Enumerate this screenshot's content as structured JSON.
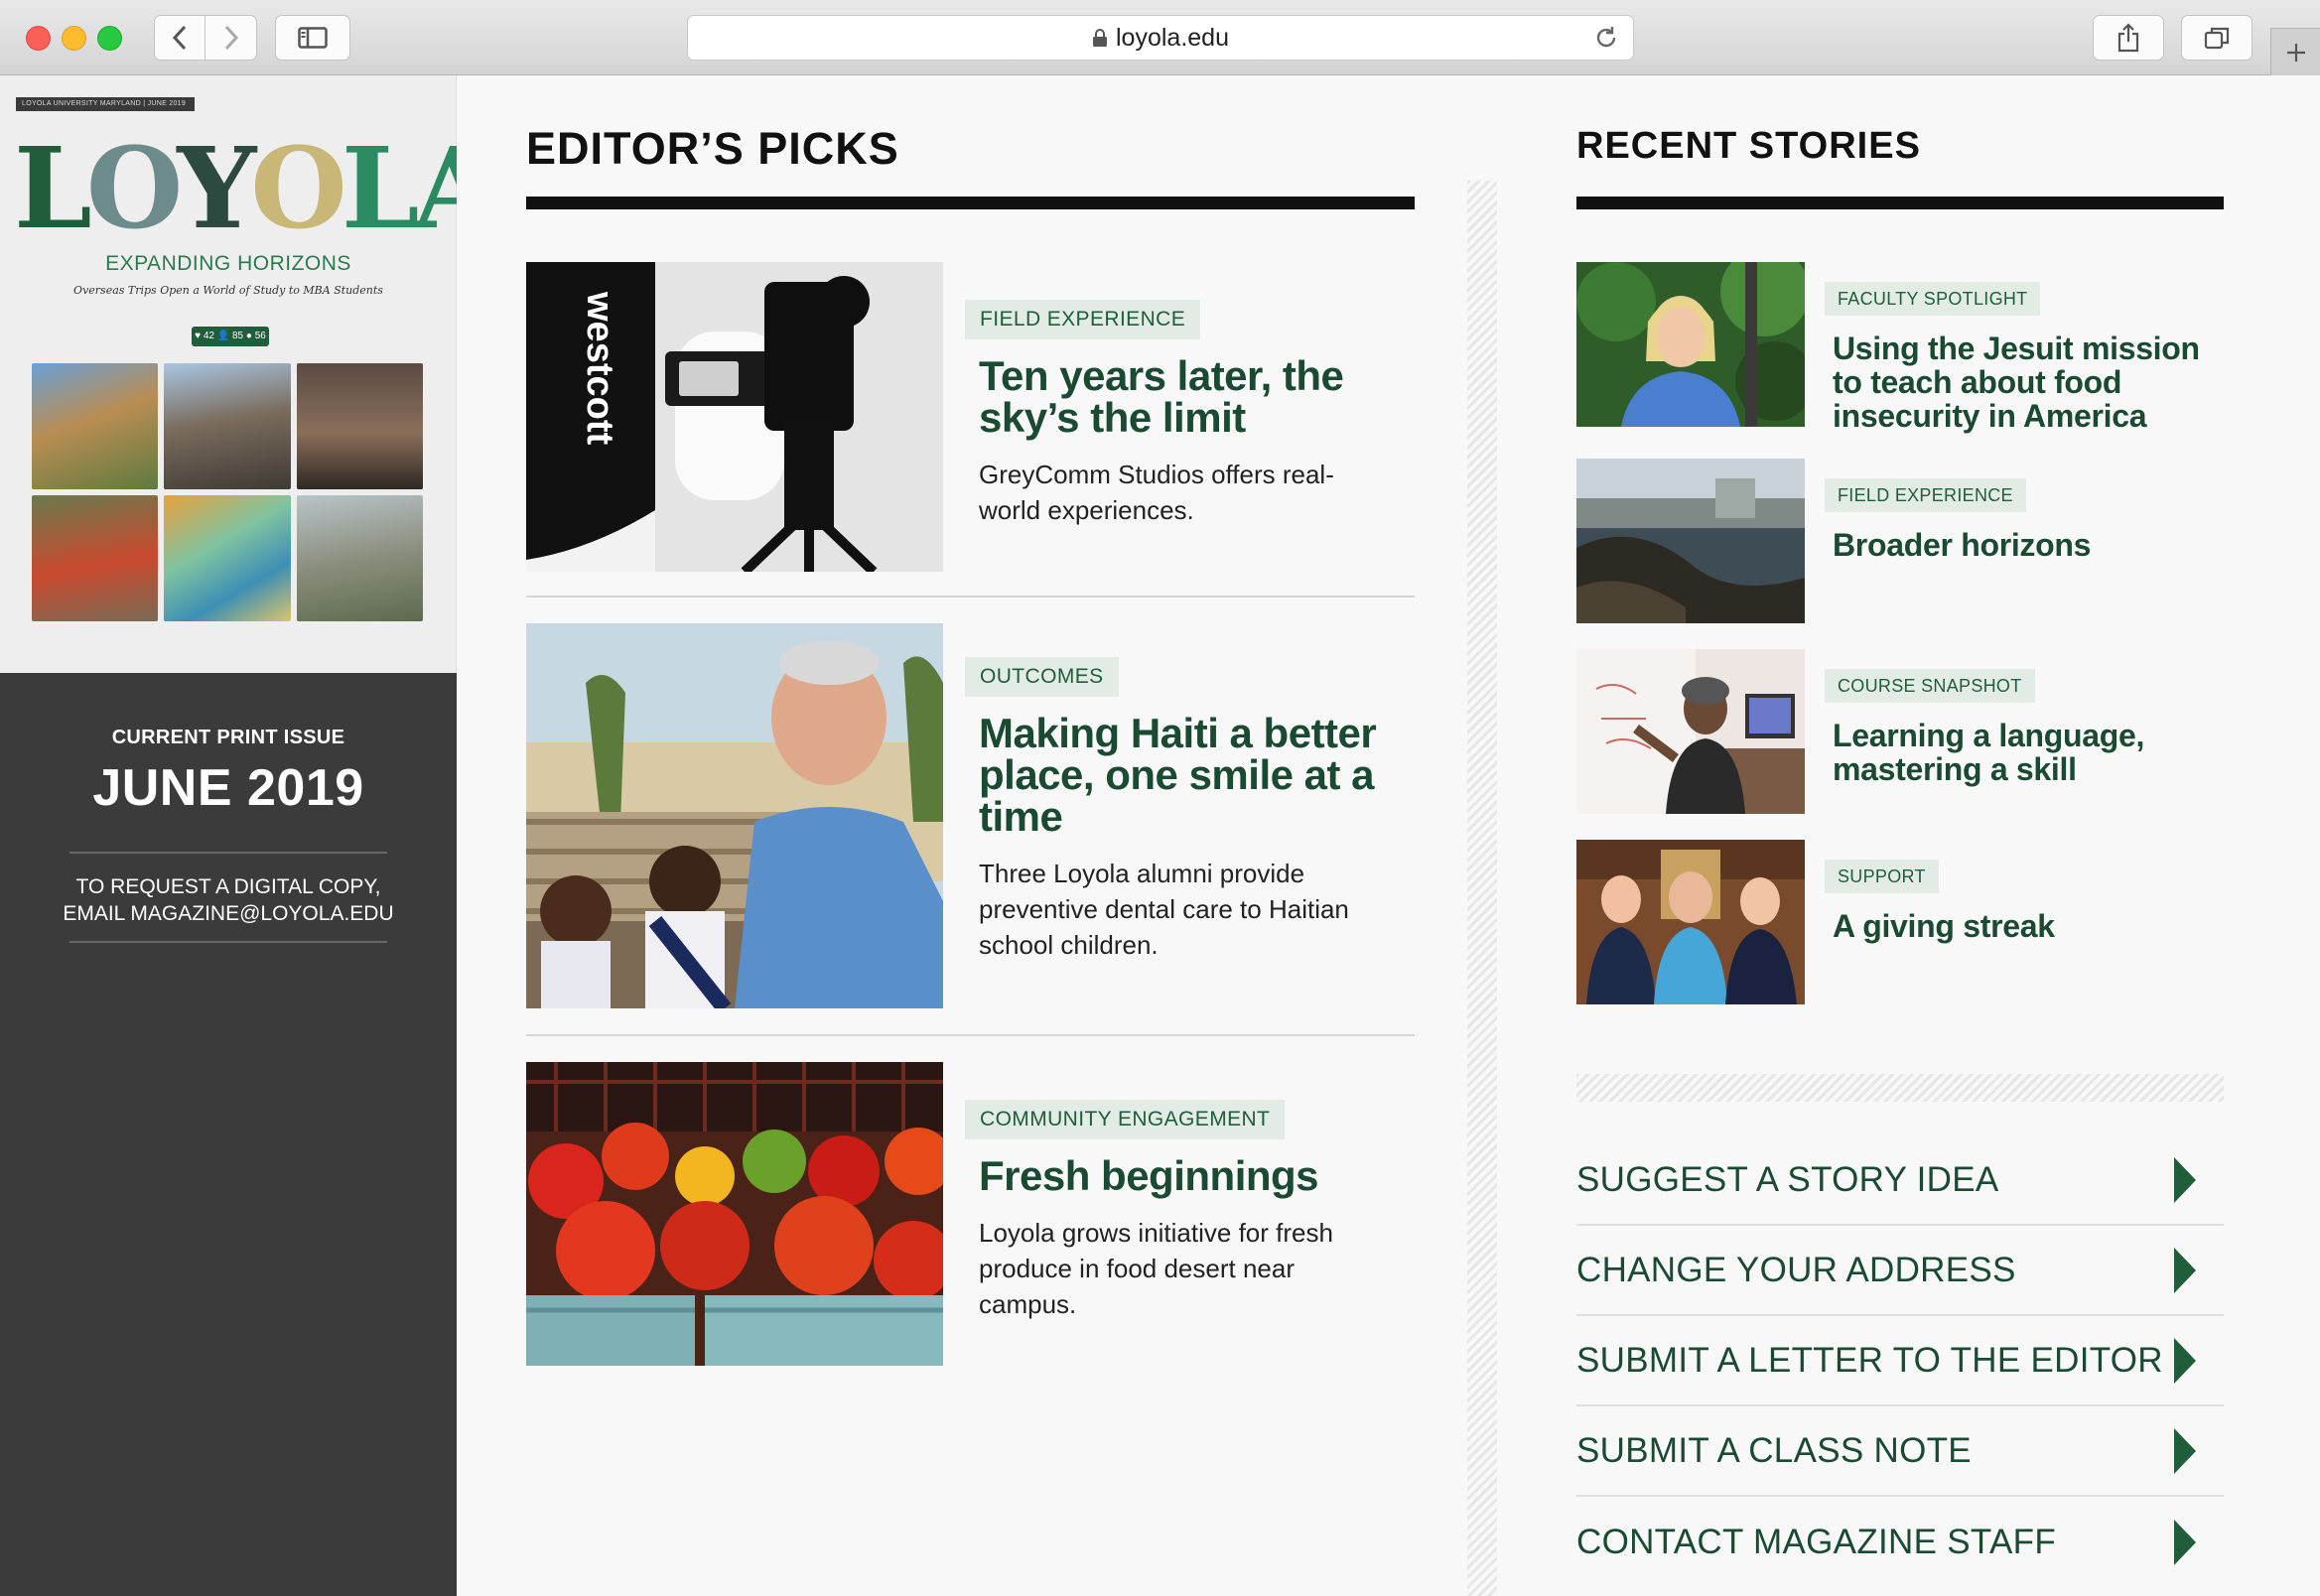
{
  "browser": {
    "url": "loyola.edu"
  },
  "cover": {
    "strip": "LOYOLA UNIVERSITY MARYLAND | JUNE 2019",
    "logo_letters": [
      "L",
      "O",
      "Y",
      "O",
      "LA"
    ],
    "headline": "EXPANDING HORIZONS",
    "subhead": "Overseas Trips Open a World of Study to MBA Students",
    "badge": "♥ 42  👤 85  ● 56"
  },
  "issue": {
    "label": "CURRENT PRINT ISSUE",
    "date": "JUNE 2019",
    "request_line1": "TO REQUEST A DIGITAL COPY,",
    "request_line2": "EMAIL MAGAZINE@LOYOLA.EDU"
  },
  "editors_picks": {
    "title": "EDITOR’S PICKS",
    "items": [
      {
        "tag": "FIELD EXPERIENCE",
        "title": "Ten years later, the sky’s the limit",
        "desc": "GreyComm Studios offers real-world experiences.",
        "image_label": "westcott"
      },
      {
        "tag": "OUTCOMES",
        "title": "Making Haiti a better place, one smile at a time",
        "desc": "Three Loyola alumni provide preventive dental care to Haitian school children."
      },
      {
        "tag": "COMMUNITY ENGAGEMENT",
        "title": "Fresh beginnings",
        "desc": "Loyola grows initiative for fresh produce in food desert near campus."
      }
    ]
  },
  "recent_stories": {
    "title": "RECENT STORIES",
    "items": [
      {
        "tag": "FACULTY SPOTLIGHT",
        "title": "Using the Jesuit mission to teach about food insecurity in America"
      },
      {
        "tag": "FIELD EXPERIENCE",
        "title": "Broader horizons"
      },
      {
        "tag": "COURSE SNAPSHOT",
        "title": "Learning a language, mastering a skill"
      },
      {
        "tag": "SUPPORT",
        "title": "A giving streak"
      }
    ]
  },
  "actions": [
    "SUGGEST A STORY IDEA",
    "CHANGE YOUR ADDRESS",
    "SUBMIT A LETTER TO THE EDITOR",
    "SUBMIT A CLASS NOTE",
    "CONTACT MAGAZINE STAFF"
  ],
  "colors": {
    "brand_green": "#1b4a32",
    "tag_bg": "#e2ece5",
    "sidebar_dark": "#3b3b3b"
  },
  "icons": [
    "back-icon",
    "forward-icon",
    "sidebar-icon",
    "lock-icon",
    "reload-icon",
    "share-icon",
    "tabs-icon",
    "plus-icon",
    "arrow-right-icon"
  ]
}
